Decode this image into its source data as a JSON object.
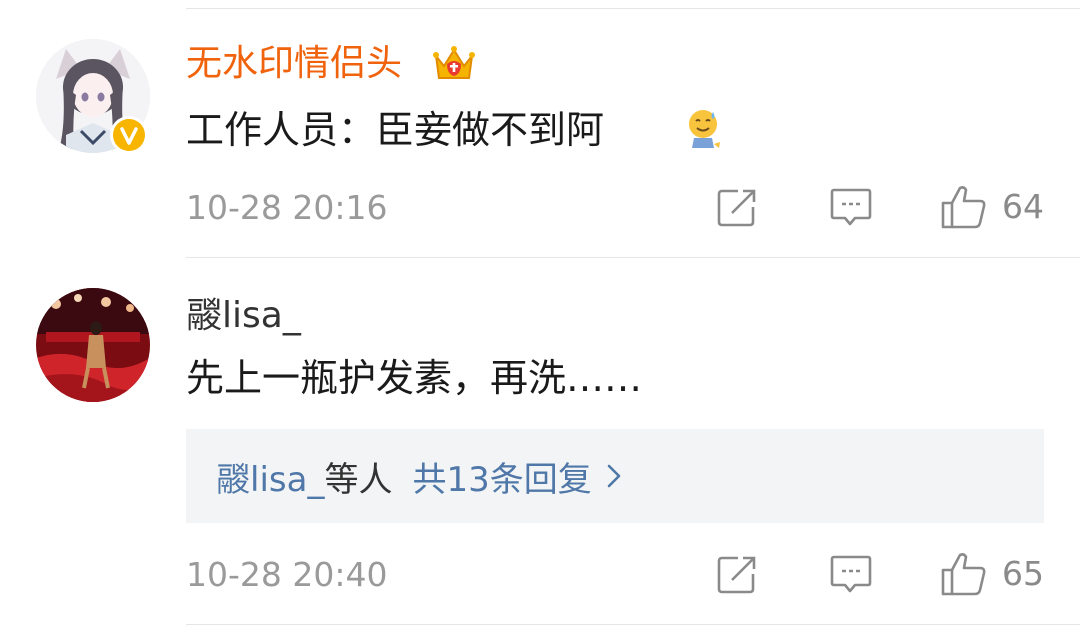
{
  "comments": [
    {
      "username": "无水印情侣头",
      "text": "工作人员：臣妾做不到阿",
      "time": "10-28 20:16",
      "likes": "64",
      "verified": true,
      "vip_crown": true,
      "emoji": "sweat-smile-emoji"
    },
    {
      "username": "鬷lisa_",
      "text": "先上一瓶护发素，再洗……",
      "time": "10-28 20:40",
      "likes": "65",
      "replies": {
        "who": "鬷lisa_",
        "etc": "等人",
        "total": "共13条回复"
      }
    }
  ],
  "colors": {
    "vip_name": "#f0620b",
    "link": "#4f77a8",
    "verified_badge": "#f7b500",
    "meta": "#9a9a9a"
  },
  "icons": [
    "share-icon",
    "comment-icon",
    "like-icon",
    "chevron-right-icon",
    "verified-badge-icon",
    "crown-icon"
  ]
}
